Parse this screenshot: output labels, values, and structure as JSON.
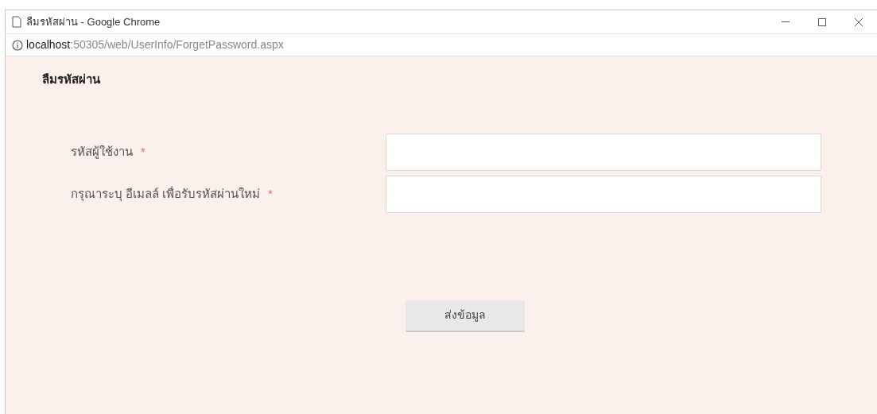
{
  "window": {
    "title": "ลืมรหัสผ่าน - Google Chrome"
  },
  "address_bar": {
    "host": "localhost",
    "path": ":50305/web/UserInfo/ForgetPassword.aspx"
  },
  "form": {
    "heading": "ลืมรหัสผ่าน",
    "fields": [
      {
        "label": "รหัสผู้ใช้งาน",
        "required_mark": "*"
      },
      {
        "label": "กรุณาระบุ อีเมลล์ เพื่อรับรหัสผ่านใหม่",
        "required_mark": "*"
      }
    ],
    "submit": "ส่งข้อมูล"
  }
}
